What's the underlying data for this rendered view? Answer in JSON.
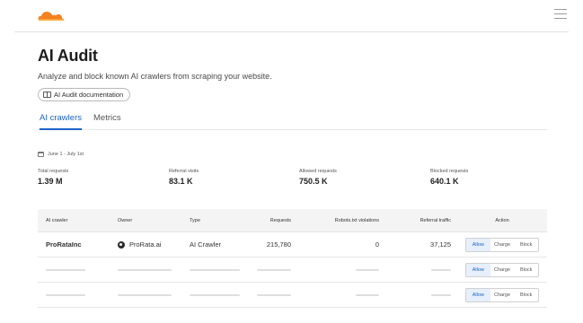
{
  "brand": {
    "logo_icon": "cloud-logo-icon",
    "accent": "#f48120",
    "link": "#1c63c9"
  },
  "header": {
    "menu_icon": "hamburger-menu-icon"
  },
  "page": {
    "title": "AI Audit",
    "subtitle": "Analyze and block known AI crawlers from scraping your website.",
    "doc_button": "AI Audit documentation"
  },
  "tabs": [
    {
      "label": "AI crawlers",
      "active": true
    },
    {
      "label": "Metrics",
      "active": false
    }
  ],
  "date_range": "June 1 - July 1st",
  "stats": [
    {
      "label": "Total requests",
      "value": "1.39 M"
    },
    {
      "label": "Referral visits",
      "value": "83.1 K"
    },
    {
      "label": "Allowed requests",
      "value": "750.5 K"
    },
    {
      "label": "Blocked requests",
      "value": "640.1 K"
    }
  ],
  "table": {
    "headers": [
      "AI crawler",
      "Owner",
      "Type",
      "Requests",
      "Robots.txt violations",
      "Referral traffic",
      "Action"
    ],
    "row1": {
      "crawler": "ProRataInc",
      "owner": "ProRata.ai",
      "type": "AI Crawler",
      "requests": "215,780",
      "violations": "0",
      "referral": "37,125"
    },
    "actions": [
      "Allow",
      "Charge",
      "Block"
    ],
    "selected_action": "Allow"
  }
}
